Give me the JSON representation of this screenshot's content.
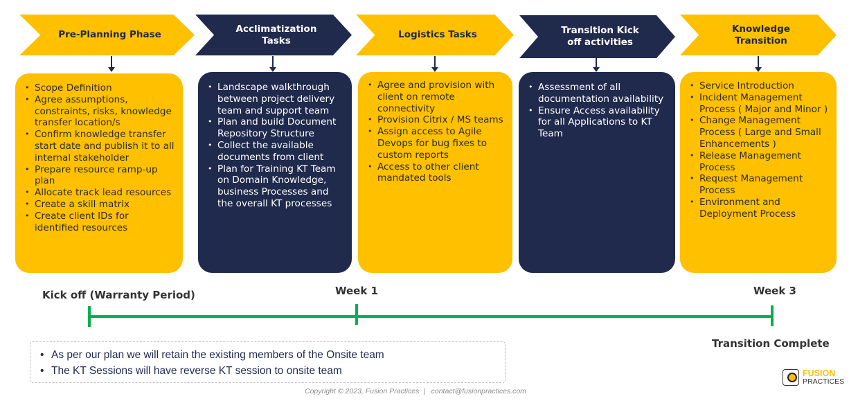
{
  "colors": {
    "yellow": "#FFC000",
    "navy": "#1F2A4D",
    "timeline_green": "#00B050"
  },
  "phases": [
    {
      "title": "Pre-Planning Phase",
      "color": "yellow",
      "items": [
        "Scope Definition",
        "Agree assumptions, constraints, risks, knowledge transfer location/s",
        "Confirm knowledge transfer start date and publish it to all internal stakeholder",
        "Prepare resource ramp-up plan",
        "Allocate track lead resources",
        "Create a skill matrix",
        "Create client IDs for identified resources"
      ]
    },
    {
      "title": "Acclimatization Tasks",
      "color": "navy",
      "items": [
        "Landscape walkthrough between project delivery team and support team",
        "Plan and build Document Repository Structure",
        "Collect the available documents from client",
        "Plan for Training KT Team on Domain Knowledge, business Processes and the overall KT processes"
      ]
    },
    {
      "title": "Logistics Tasks",
      "color": "yellow",
      "items": [
        "Agree and provision with client on remote connectivity",
        "Provision Citrix / MS teams",
        "Assign access to Agile Devops for bug fixes to custom reports",
        "Access to other client mandated tools"
      ]
    },
    {
      "title": "Transition Kick off activities",
      "color": "navy",
      "items": [
        "Assessment of all documentation availability",
        "Ensure Access availability for all Applications to KT Team"
      ]
    },
    {
      "title": "Knowledge Transition",
      "color": "yellow",
      "items": [
        "Service Introduction",
        "Incident Management Process ( Major and Minor )",
        "Change Management Process ( Large and Small Enhancements )",
        "Release Management Process",
        "Request Management Process",
        "Environment and Deployment Process"
      ]
    }
  ],
  "timeline": {
    "start_label": "Kick off (Warranty Period)",
    "mid_label": "Week 1",
    "end_label": "Week 3",
    "end_caption": "Transition Complete"
  },
  "notes": [
    "As per our plan we will retain the existing members of the Onsite team",
    "The KT Sessions will have reverse KT session to onsite team"
  ],
  "footer": {
    "text": "Copyright © 2023, Fusion Practices  |   contact@fusionpractices.com"
  },
  "logo": {
    "line1": "FUSION",
    "line2": "PRACTICES",
    "icon": "fusion-logo-icon"
  }
}
